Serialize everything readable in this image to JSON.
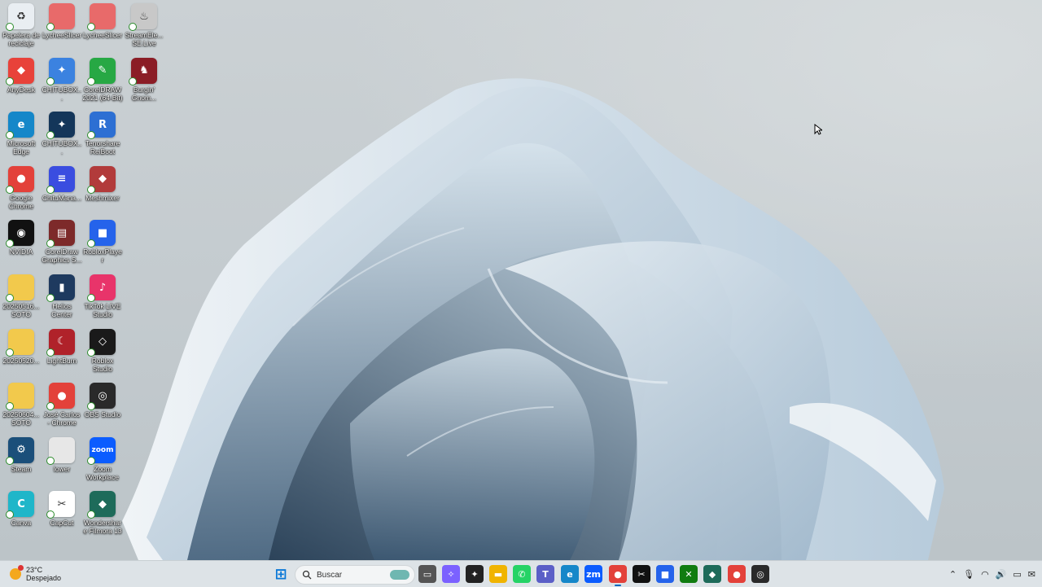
{
  "desktop_icons": [
    {
      "label": "Papelera de reciclaje",
      "color": "#e9eef2",
      "symbol": "♻",
      "icon": "recycle-bin-icon"
    },
    {
      "label": "LycheeSlicer",
      "color": "#e86a6a",
      "symbol": "",
      "icon": "lychee-slicer-icon"
    },
    {
      "label": "LycheeSlicer",
      "color": "#e86a6a",
      "symbol": "",
      "icon": "lychee-slicer-icon"
    },
    {
      "label": "StreamEle... SE.Live",
      "color": "#c8c8c8",
      "symbol": "♨",
      "icon": "streamelements-icon"
    },
    {
      "label": "AnyDesk",
      "color": "#e8423a",
      "symbol": "◆",
      "icon": "anydesk-icon"
    },
    {
      "label": "CHITUBOX...",
      "color": "#3b82e0",
      "symbol": "✦",
      "icon": "chitubox-icon"
    },
    {
      "label": "CorelDRAW 2021 (64-Bit)",
      "color": "#27a844",
      "symbol": "✎",
      "icon": "coreldraw-icon"
    },
    {
      "label": "Burgin' Gnom...",
      "color": "#8b1d26",
      "symbol": "♞",
      "icon": "burgin-gnome-icon"
    },
    {
      "label": "Microsoft Edge",
      "color": "#1587c9",
      "symbol": "e",
      "icon": "edge-icon"
    },
    {
      "label": "CHITUBOX...",
      "color": "#14365a",
      "symbol": "✦",
      "icon": "chitubox-icon"
    },
    {
      "label": "Tenorshare ReiBoot",
      "color": "#2d6fd3",
      "symbol": "R",
      "icon": "reiboot-icon"
    },
    {
      "label": "Google Chrome",
      "color": "#e3413a",
      "symbol": "●",
      "icon": "chrome-icon"
    },
    {
      "label": "ChituMana...",
      "color": "#3a4de0",
      "symbol": "≡",
      "icon": "chitumanager-icon"
    },
    {
      "label": "Meshmixer",
      "color": "#b23b3b",
      "symbol": "◆",
      "icon": "meshmixer-icon"
    },
    {
      "label": "NVIDIA",
      "color": "#111111",
      "symbol": "◉",
      "icon": "nvidia-icon"
    },
    {
      "label": "CorelDraw Graphics S...",
      "color": "#7d2a2a",
      "symbol": "▤",
      "icon": "winrar-icon"
    },
    {
      "label": "RobloxPlayer",
      "color": "#2563eb",
      "symbol": "■",
      "icon": "roblox-player-icon"
    },
    {
      "label": "20250516... SOTO",
      "color": "#f2c94c",
      "symbol": "",
      "icon": "folder-icon"
    },
    {
      "label": "Helios Center",
      "color": "#1e3a5f",
      "symbol": "▮",
      "icon": "helios-center-icon"
    },
    {
      "label": "TikTok LIVE Studio",
      "color": "#e8346a",
      "symbol": "♪",
      "icon": "tiktok-live-icon"
    },
    {
      "label": "20250520...",
      "color": "#f2c94c",
      "symbol": "",
      "icon": "folder-icon"
    },
    {
      "label": "LightBurn",
      "color": "#b0222a",
      "symbol": "☾",
      "icon": "lightburn-icon"
    },
    {
      "label": "Roblox Studio",
      "color": "#1a1a1a",
      "symbol": "◇",
      "icon": "roblox-studio-icon"
    },
    {
      "label": "20250604... SOTO",
      "color": "#f2c94c",
      "symbol": "",
      "icon": "folder-icon"
    },
    {
      "label": "José Carlos - Chrome",
      "color": "#e3413a",
      "symbol": "●",
      "icon": "chrome-profile-icon"
    },
    {
      "label": "OBS Studio",
      "color": "#2a2a2a",
      "symbol": "◎",
      "icon": "obs-icon"
    },
    {
      "label": "Steam",
      "color": "#1b4f7a",
      "symbol": "⚙",
      "icon": "steam-icon"
    },
    {
      "label": "lower",
      "color": "#e7e7e7",
      "symbol": "",
      "icon": "blank-file-icon"
    },
    {
      "label": "Zoom Workplace",
      "color": "#0b5cff",
      "symbol": "zoom",
      "icon": "zoom-icon"
    },
    {
      "label": "Canva",
      "color": "#1fb6c9",
      "symbol": "C",
      "icon": "canva-icon"
    },
    {
      "label": "CapCut",
      "color": "#ffffff",
      "symbol": "✂",
      "icon": "capcut-icon"
    },
    {
      "label": "Wondershare Filmora 13",
      "color": "#1e6b5a",
      "symbol": "◆",
      "icon": "filmora-icon"
    }
  ],
  "weather": {
    "temp": "23°C",
    "condition": "Despejado"
  },
  "taskbar": {
    "search_label": "Buscar",
    "apps": [
      {
        "icon": "start-icon",
        "color": "#0a78d7",
        "symbol": "⊞"
      },
      {
        "icon": "task-view-icon",
        "color": "#555555",
        "symbol": "▭"
      },
      {
        "icon": "copilot-icon",
        "color": "#7b61ff",
        "symbol": "✧"
      },
      {
        "icon": "chitubox-taskbar-icon",
        "color": "#222222",
        "symbol": "✦"
      },
      {
        "icon": "file-explorer-icon",
        "color": "#f0b400",
        "symbol": "▬"
      },
      {
        "icon": "whatsapp-icon",
        "color": "#25d366",
        "symbol": "✆"
      },
      {
        "icon": "teams-icon",
        "color": "#5b5fc7",
        "symbol": "T"
      },
      {
        "icon": "edge-taskbar-icon",
        "color": "#1587c9",
        "symbol": "e"
      },
      {
        "icon": "zoom-taskbar-icon",
        "color": "#0b5cff",
        "symbol": "zm"
      },
      {
        "icon": "chrome-taskbar-icon",
        "color": "#e3413a",
        "symbol": "●"
      },
      {
        "icon": "capcut-taskbar-icon",
        "color": "#111111",
        "symbol": "✂"
      },
      {
        "icon": "roblox-taskbar-icon",
        "color": "#2563eb",
        "symbol": "■"
      },
      {
        "icon": "xbox-icon",
        "color": "#107c10",
        "symbol": "✕"
      },
      {
        "icon": "filmora-taskbar-icon",
        "color": "#1e6b5a",
        "symbol": "◆"
      },
      {
        "icon": "chrome-profile-taskbar-icon",
        "color": "#e3413a",
        "symbol": "●"
      },
      {
        "icon": "obs-taskbar-icon",
        "color": "#2a2a2a",
        "symbol": "◎"
      }
    ]
  },
  "tray": [
    {
      "icon": "chevron-up-icon",
      "symbol": "⌃"
    },
    {
      "icon": "microphone-icon",
      "symbol": "🎙"
    },
    {
      "icon": "wifi-icon",
      "symbol": "◠"
    },
    {
      "icon": "volume-icon",
      "symbol": "🔊"
    },
    {
      "icon": "battery-icon",
      "symbol": "▭"
    },
    {
      "icon": "notification-icon",
      "symbol": "✉"
    }
  ]
}
